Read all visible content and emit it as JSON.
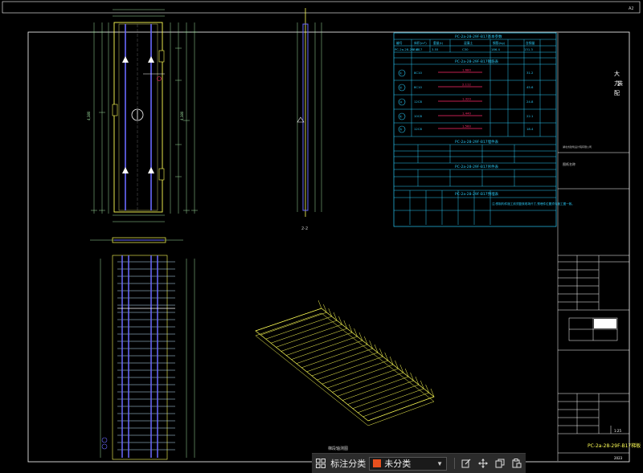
{
  "drawing": {
    "page_corner": "A2",
    "drawing_number": "PC-2a-28-29F-B17梯板",
    "scale_label": "1:25",
    "year": "2023",
    "section_label": "2-2",
    "view_label_3d": "梯段轴测图",
    "title_block_heading": "图纸名称",
    "design_unit_note": "湖北省建筑设计院有限公司",
    "title_right": [
      "大",
      "力",
      "装",
      "配"
    ]
  },
  "tables": {
    "t1_title": "PC-2a-28-29F-B17基本参数",
    "t1_headers": [
      "编号",
      "体积(m³)",
      "重量(t)",
      "混凝土",
      "钢筋(kg)",
      "含钢量"
    ],
    "t1_row": [
      "PC-2a-28-29F-B17",
      "1.42",
      "3.55",
      "C30",
      "186.4",
      "131.3"
    ],
    "t2_title": "PC-2a-28-29F-B17钢筋表",
    "t2_rows": [
      [
        "①",
        "8C10",
        "1,680",
        "31.2"
      ],
      [
        "②",
        "8C10",
        "2,112",
        "45.6"
      ],
      [
        "③",
        "12C8",
        "1,320",
        "24.8"
      ],
      [
        "④",
        "10C8",
        "1,440",
        "22.1"
      ],
      [
        "⑤",
        "12C8",
        "1,560",
        "18.4"
      ]
    ],
    "t3_title": "PC-2a-28-29F-B17埋件表",
    "t4_title": "PC-2a-28-29F-B17吊件表",
    "t5_title": "PC-2a-28-29F-B17预埋表",
    "note": "注:预制构件施工前须复核现场尺寸,预埋件位置须与施工图一致。"
  },
  "toolbar": {
    "grid_icon": "grid-icon",
    "category_label": "标注分类",
    "category_value": "未分类",
    "category_color": "#e8501e",
    "tools": [
      "edit-icon",
      "move-icon",
      "copy-icon",
      "paste-icon"
    ]
  },
  "colors": {
    "frame": "#ffffff",
    "dimension": "#9fe0a0",
    "rebar": "#6a6aff",
    "stirrup": "#bfe6ff",
    "table": "#2ac8f5",
    "highlight": "#ff2a6a",
    "outline": "#ffff55"
  }
}
